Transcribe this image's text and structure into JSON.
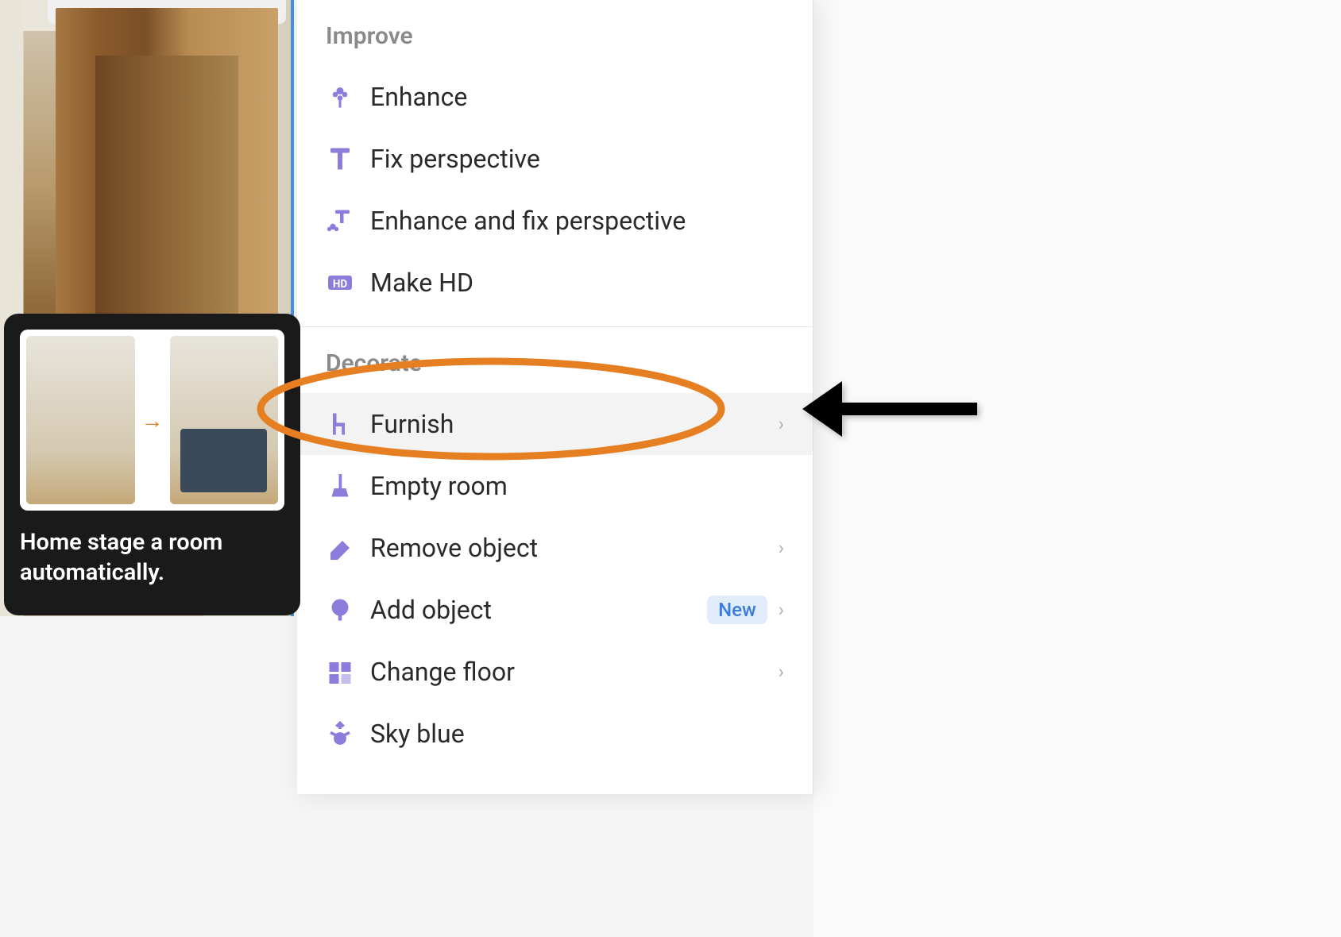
{
  "tooltip": {
    "text": "Home stage a room automatically."
  },
  "menu": {
    "sections": {
      "improve": {
        "header": "Improve",
        "items": {
          "enhance": "Enhance",
          "fix_perspective": "Fix perspective",
          "enhance_fix": "Enhance and fix perspective",
          "make_hd": "Make HD"
        }
      },
      "decorate": {
        "header": "Decorate",
        "items": {
          "furnish": "Furnish",
          "empty_room": "Empty room",
          "remove_object": "Remove object",
          "add_object": "Add object",
          "change_floor": "Change floor",
          "sky_blue": "Sky blue"
        }
      }
    },
    "badge_new": "New"
  },
  "colors": {
    "accent": "#8b7ddb",
    "annotation": "#e67e22"
  }
}
